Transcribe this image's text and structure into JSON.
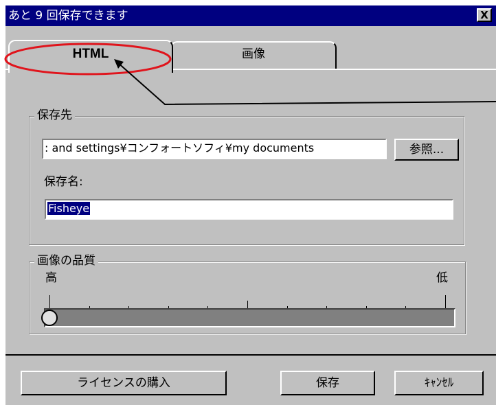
{
  "window": {
    "title": "あと 9 回保存できます",
    "close_label": "X"
  },
  "tabs": [
    {
      "label": "HTML",
      "active": true
    },
    {
      "label": "画像",
      "active": false
    }
  ],
  "save_location": {
    "group_title": "保存先",
    "path_value": ": and settings¥コンフォートソフィ¥my documents",
    "browse_label": "参照..."
  },
  "save_name": {
    "label": "保存名:",
    "value": "Fisheye"
  },
  "quality": {
    "group_title": "画像の品質",
    "high_label": "高",
    "low_label": "低",
    "level": 1.0,
    "tick_count": 11
  },
  "buttons": {
    "purchase": "ライセンスの購入",
    "save": "保存",
    "cancel": "ｷｬﾝｾﾙ"
  },
  "annotation": {
    "highlight_color": "#e0141c"
  }
}
